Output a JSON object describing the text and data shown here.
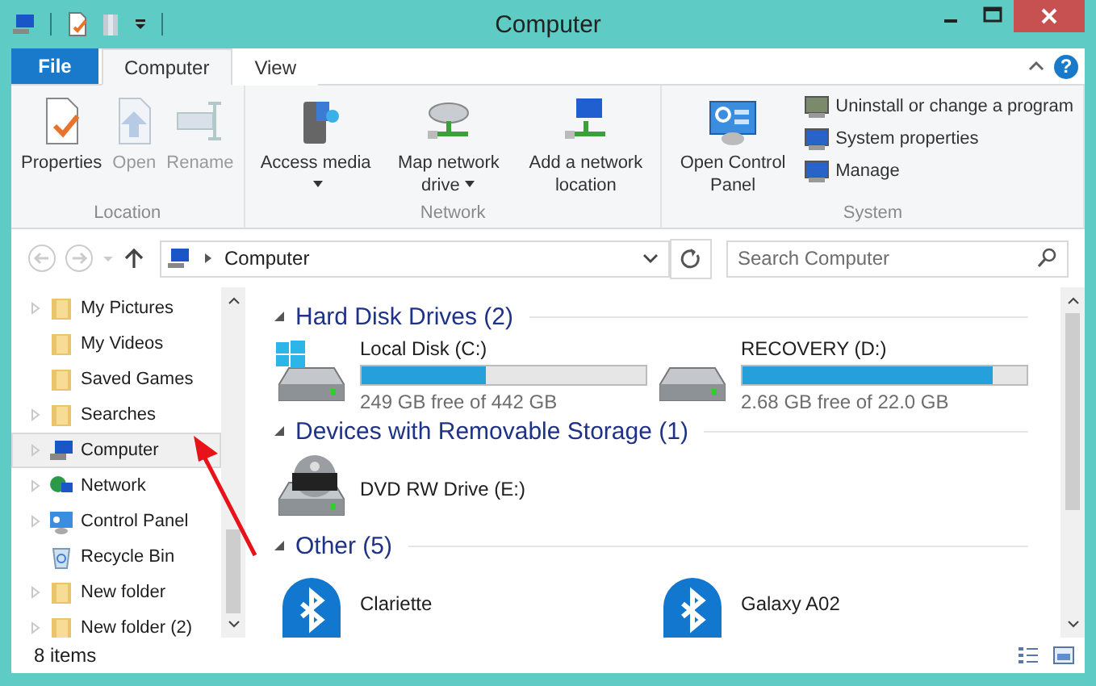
{
  "window": {
    "title": "Computer"
  },
  "tabs": [
    {
      "label": "File",
      "kind": "file",
      "selected": false
    },
    {
      "label": "Computer",
      "kind": "tab",
      "selected": true
    },
    {
      "label": "View",
      "kind": "tab",
      "selected": false
    }
  ],
  "help_button": "?",
  "ribbon": {
    "groups": [
      {
        "label": "Location",
        "buttons": [
          {
            "label": "Properties",
            "disabled": false,
            "dropdown": false
          },
          {
            "label": "Open",
            "disabled": true,
            "dropdown": false
          },
          {
            "label": "Rename",
            "disabled": true,
            "dropdown": false
          }
        ]
      },
      {
        "label": "Network",
        "buttons": [
          {
            "label": "Access media",
            "disabled": false,
            "dropdown": true
          },
          {
            "label": "Map network drive",
            "disabled": false,
            "dropdown": true
          },
          {
            "label": "Add a network location",
            "disabled": false,
            "dropdown": false
          }
        ]
      },
      {
        "label": "System",
        "buttons": [
          {
            "label": "Open Control Panel",
            "disabled": false,
            "dropdown": false
          }
        ],
        "small_buttons": [
          {
            "label": "Uninstall or change a program"
          },
          {
            "label": "System properties"
          },
          {
            "label": "Manage"
          }
        ]
      }
    ]
  },
  "address_bar": {
    "path": "Computer"
  },
  "search": {
    "placeholder": "Search Computer"
  },
  "sidebar": {
    "items": [
      {
        "label": "My Pictures",
        "kind": "folder",
        "expandable": true,
        "selected": false
      },
      {
        "label": "My Videos",
        "kind": "folder",
        "expandable": false,
        "selected": false
      },
      {
        "label": "Saved Games",
        "kind": "folder",
        "expandable": false,
        "selected": false
      },
      {
        "label": "Searches",
        "kind": "folder",
        "expandable": true,
        "selected": false
      },
      {
        "label": "Computer",
        "kind": "computer",
        "expandable": true,
        "selected": true
      },
      {
        "label": "Network",
        "kind": "network",
        "expandable": true,
        "selected": false
      },
      {
        "label": "Control Panel",
        "kind": "control",
        "expandable": true,
        "selected": false
      },
      {
        "label": "Recycle Bin",
        "kind": "recycle",
        "expandable": false,
        "selected": false
      },
      {
        "label": "New folder",
        "kind": "folder",
        "expandable": true,
        "selected": false
      },
      {
        "label": "New folder (2)",
        "kind": "folder",
        "expandable": true,
        "selected": false
      }
    ]
  },
  "content": {
    "sections": [
      {
        "title": "Hard Disk Drives (2)",
        "items": [
          {
            "kind": "system-disk",
            "name": "Local Disk (C:)",
            "level": 0.44,
            "free": "249 GB free of 442 GB"
          },
          {
            "kind": "disk",
            "name": "RECOVERY (D:)",
            "level": 0.88,
            "free": "2.68 GB free of 22.0 GB"
          }
        ]
      },
      {
        "title": "Devices with Removable Storage (1)",
        "items": [
          {
            "kind": "dvd",
            "name": "DVD RW Drive (E:)"
          }
        ]
      },
      {
        "title": "Other (5)",
        "items": [
          {
            "kind": "bluetooth",
            "name": "Clariette"
          },
          {
            "kind": "bluetooth",
            "name": "Galaxy A02"
          }
        ]
      }
    ]
  },
  "status_bar": {
    "count": "8 items"
  }
}
